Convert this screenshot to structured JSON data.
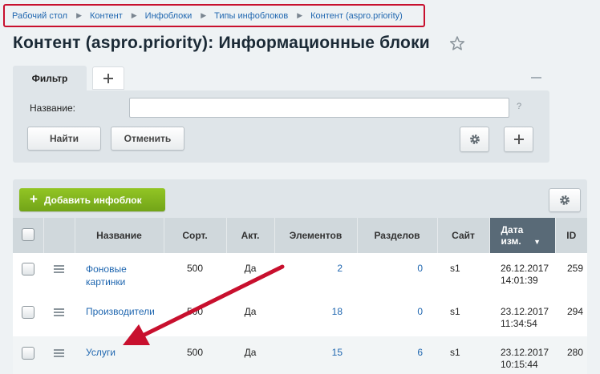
{
  "breadcrumb": [
    "Рабочий стол",
    "Контент",
    "Инфоблоки",
    "Типы инфоблоков",
    "Контент (aspro.priority)"
  ],
  "page_title": "Контент (aspro.priority): Информационные блоки",
  "filter": {
    "tab_label": "Фильтр",
    "name_label": "Название:",
    "name_value": "",
    "help": "?",
    "find_label": "Найти",
    "cancel_label": "Отменить"
  },
  "toolbar": {
    "add_label": "Добавить инфоблок"
  },
  "table": {
    "headers": {
      "name": "Название",
      "sort": "Сорт.",
      "active": "Акт.",
      "elements": "Элементов",
      "sections": "Разделов",
      "site": "Сайт",
      "date_line1": "Дата",
      "date_line2": "изм.",
      "id": "ID"
    },
    "rows": [
      {
        "name": "Фоновые картинки",
        "sort": "500",
        "active": "Да",
        "elements": "2",
        "sections": "0",
        "site": "s1",
        "date": "26.12.2017",
        "time": "14:01:39",
        "id": "259"
      },
      {
        "name": "Производители",
        "sort": "500",
        "active": "Да",
        "elements": "18",
        "sections": "0",
        "site": "s1",
        "date": "23.12.2017",
        "time": "11:34:54",
        "id": "294"
      },
      {
        "name": "Услуги",
        "sort": "500",
        "active": "Да",
        "elements": "15",
        "sections": "6",
        "site": "s1",
        "date": "23.12.2017",
        "time": "10:15:44",
        "id": "280"
      }
    ]
  },
  "colors": {
    "accent_red": "#c8102e",
    "link": "#2067b0",
    "add_green": "#7cb01c",
    "sorted_header": "#596a77"
  }
}
